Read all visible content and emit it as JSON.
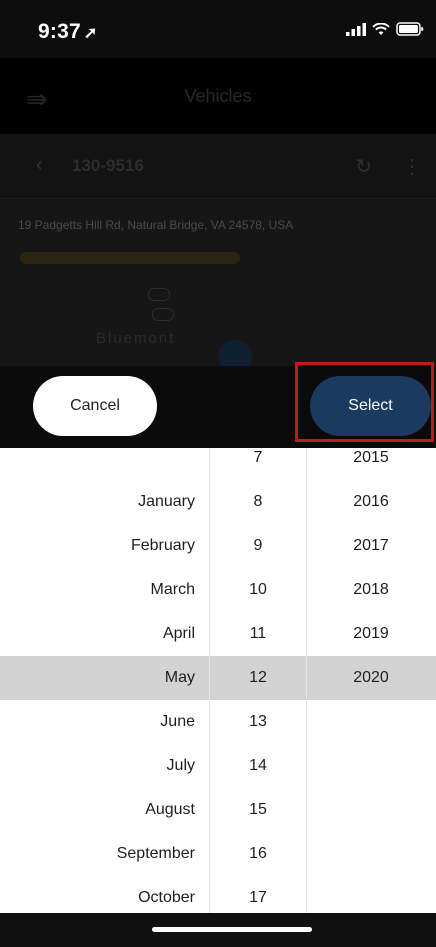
{
  "status_bar": {
    "time": "9:37",
    "location_icon": "location-arrow-icon",
    "icons": [
      "signal-icon",
      "wifi-icon",
      "battery-icon"
    ]
  },
  "app_bar": {
    "menu_icon": "menu-arrow-icon",
    "title": "Vehicles"
  },
  "vehicle_bar": {
    "back_icon": "chevron-left-icon",
    "vehicle_id": "130-9516",
    "refresh_icon": "refresh-icon",
    "more_icon": "more-vertical-icon"
  },
  "map": {
    "address": "19 Padgetts Hill Rd, Natural Bridge, VA 24578, USA",
    "place": "Bluemont"
  },
  "picker_actions": {
    "cancel": "Cancel",
    "select": "Select"
  },
  "picker": {
    "months": [
      "January",
      "February",
      "March",
      "April",
      "May",
      "June",
      "July",
      "August",
      "September",
      "October"
    ],
    "days": [
      "7",
      "8",
      "9",
      "10",
      "11",
      "12",
      "13",
      "14",
      "15",
      "16",
      "17"
    ],
    "years": [
      "2015",
      "2016",
      "2017",
      "2018",
      "2019",
      "2020"
    ],
    "selected": {
      "month": "May",
      "day": "12",
      "year": "2020"
    }
  },
  "colors": {
    "select_button": "#1a3a5f",
    "highlight_box": "#c51818",
    "selection_band": "#d3d3d3"
  }
}
